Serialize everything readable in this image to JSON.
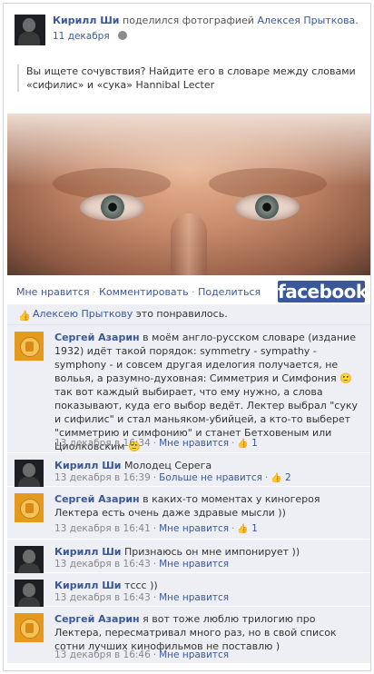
{
  "post": {
    "poster_name": "Кирилл Ши",
    "action_text": "поделился фотографией",
    "photo_owner": "Алексея Прыткова.",
    "date": "11 декабря",
    "privacy_icon": "globe-icon",
    "quote": "Вы ищете сочувствия? Найдите его в словаре между словами «сифилис» и «сука» Hannibal Lecter"
  },
  "actions": {
    "like": "Мне нравится",
    "comment": "Комментировать",
    "share": "Поделиться",
    "sep": "·"
  },
  "brand": {
    "logo_text": "facebook",
    "color": "#3b5998"
  },
  "likes_line": {
    "name": "Алексею Прыткову",
    "suffix": " это понравилось."
  },
  "comments": [
    {
      "author": "Сергей Азарин",
      "avatar": "orange",
      "text": "в моём англо-русском словаре (издание 1932) идёт такой порядок: symmetry - sympathy - symphony - и совсем другая иделогия получается, не вольья, а разумно-духовная: Симметрия и Симфония 🙂 так вот каждый выбирает, что ему нужно, а слова показывают, куда его выбор ведёт. Лектер выбрал \"суку и сифилис\" и стал маньяком-убийцей, а кто-то выберет \"симметрию и симфонию\" и станет Бетховеным или Циолковским 🙂",
      "time": "13 декабря в 16:34",
      "like": "Мне нравится",
      "likes": "1"
    },
    {
      "author": "Кирилл Ши",
      "avatar": "dark",
      "text": "Молодец Серега",
      "time": "13 декабря в 16:39",
      "like": "Больше не нравится",
      "likes": "2"
    },
    {
      "author": "Сергей Азарин",
      "avatar": "orange",
      "text": "в каких-то моментах у киногероя Лектера есть очень даже здравые мысли ))",
      "time": "13 декабря в 16:41",
      "like": "Мне нравится",
      "likes": "1"
    },
    {
      "author": "Кирилл Ши",
      "avatar": "dark",
      "text": "Признаюсь он мне импонирует ))",
      "time": "13 декабря в 16:43",
      "like": "Мне нравится",
      "likes": ""
    },
    {
      "author": "Кирилл Ши",
      "avatar": "dark",
      "text": "тссс ))",
      "time": "13 декабря в 16:43",
      "like": "Мне нравится",
      "likes": ""
    },
    {
      "author": "Сергей Азарин",
      "avatar": "orange",
      "text": "я вот тоже люблю трилогию про Лектера, пересматривал много раз, но в свой список сотни лучших кинофильмов не поставлю )",
      "time": "13 декабря в 16:46",
      "like": "Мне нравится",
      "likes": ""
    }
  ]
}
